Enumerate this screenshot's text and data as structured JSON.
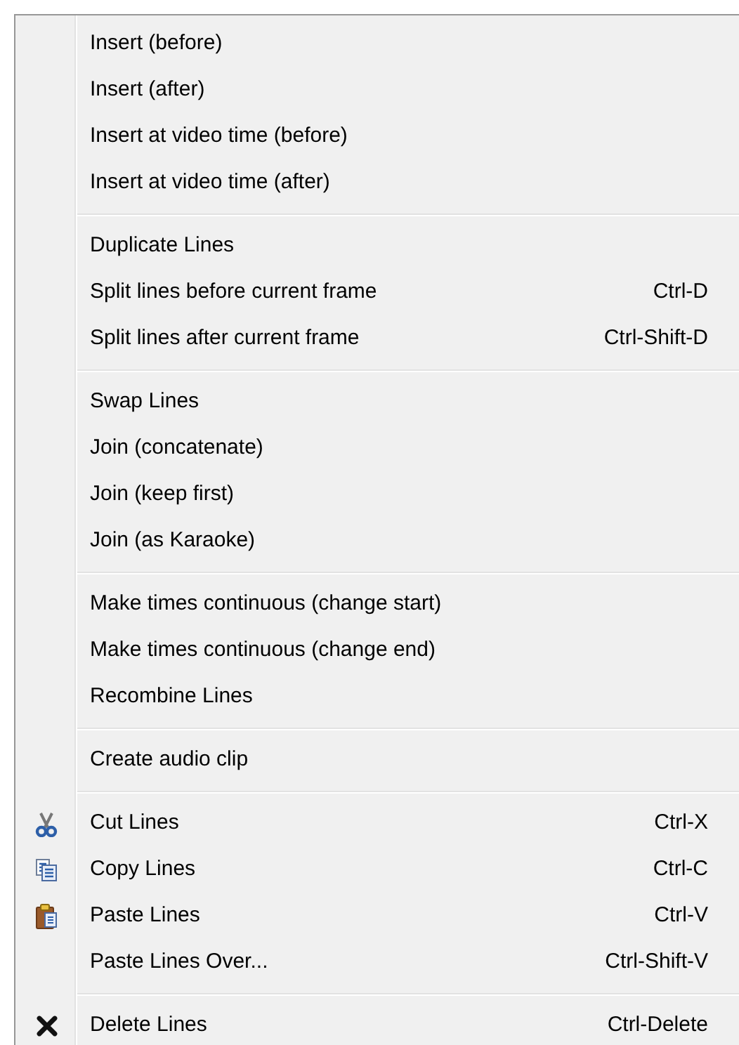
{
  "menu": {
    "groups": [
      {
        "items": [
          {
            "kind": "plain",
            "label": "Insert (before)"
          },
          {
            "kind": "plain",
            "label": "Insert (after)"
          },
          {
            "kind": "plain",
            "label": "Insert at video time (before)"
          },
          {
            "kind": "plain",
            "label": "Insert at video time (after)"
          }
        ]
      },
      {
        "items": [
          {
            "kind": "plain",
            "label": "Duplicate Lines"
          },
          {
            "kind": "plain",
            "label": "Split lines before current frame",
            "shortcut": "Ctrl-D"
          },
          {
            "kind": "plain",
            "label": "Split lines after current frame",
            "shortcut": "Ctrl-Shift-D"
          }
        ]
      },
      {
        "items": [
          {
            "kind": "plain",
            "label": "Swap Lines"
          },
          {
            "kind": "plain",
            "label": "Join (concatenate)"
          },
          {
            "kind": "plain",
            "label": "Join (keep first)"
          },
          {
            "kind": "plain",
            "label": "Join (as Karaoke)"
          }
        ]
      },
      {
        "items": [
          {
            "kind": "plain",
            "label": "Make times continuous (change start)"
          },
          {
            "kind": "plain",
            "label": "Make times continuous (change end)"
          },
          {
            "kind": "plain",
            "label": "Recombine Lines"
          }
        ]
      },
      {
        "items": [
          {
            "kind": "plain",
            "label": "Create audio clip"
          }
        ]
      },
      {
        "items": [
          {
            "kind": "cut",
            "label": "Cut Lines",
            "shortcut": "Ctrl-X"
          },
          {
            "kind": "copy",
            "label": "Copy Lines",
            "shortcut": "Ctrl-C"
          },
          {
            "kind": "paste",
            "label": "Paste Lines",
            "shortcut": "Ctrl-V"
          },
          {
            "kind": "plain",
            "label": "Paste Lines Over...",
            "shortcut": "Ctrl-Shift-V"
          }
        ]
      },
      {
        "items": [
          {
            "kind": "delete",
            "label": "Delete Lines",
            "shortcut": "Ctrl-Delete"
          }
        ]
      }
    ]
  }
}
